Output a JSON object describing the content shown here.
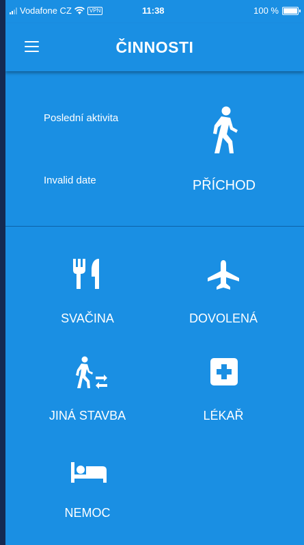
{
  "status_bar": {
    "carrier": "Vodafone CZ",
    "vpn": "VPN",
    "time": "11:38",
    "battery": "100 %"
  },
  "header": {
    "title": "ČINNOSTI",
    "menu_icon": "hamburger-menu-icon"
  },
  "last_activity": {
    "label": "Poslední aktivita",
    "date": "Invalid date",
    "action_label": "PŘÍCHOD",
    "action_icon": "walking-person-icon"
  },
  "activities": [
    {
      "label": "SVAČINA",
      "icon": "utensils-icon"
    },
    {
      "label": "DOVOLENÁ",
      "icon": "airplane-icon"
    },
    {
      "label": "JINÁ STAVBA",
      "icon": "person-transfer-icon"
    },
    {
      "label": "LÉKAŘ",
      "icon": "medical-cross-icon"
    },
    {
      "label": "NEMOC",
      "icon": "bed-icon"
    }
  ],
  "colors": {
    "primary": "#1a8fe3",
    "background": "#142a52",
    "divider": "#0d63a8"
  }
}
